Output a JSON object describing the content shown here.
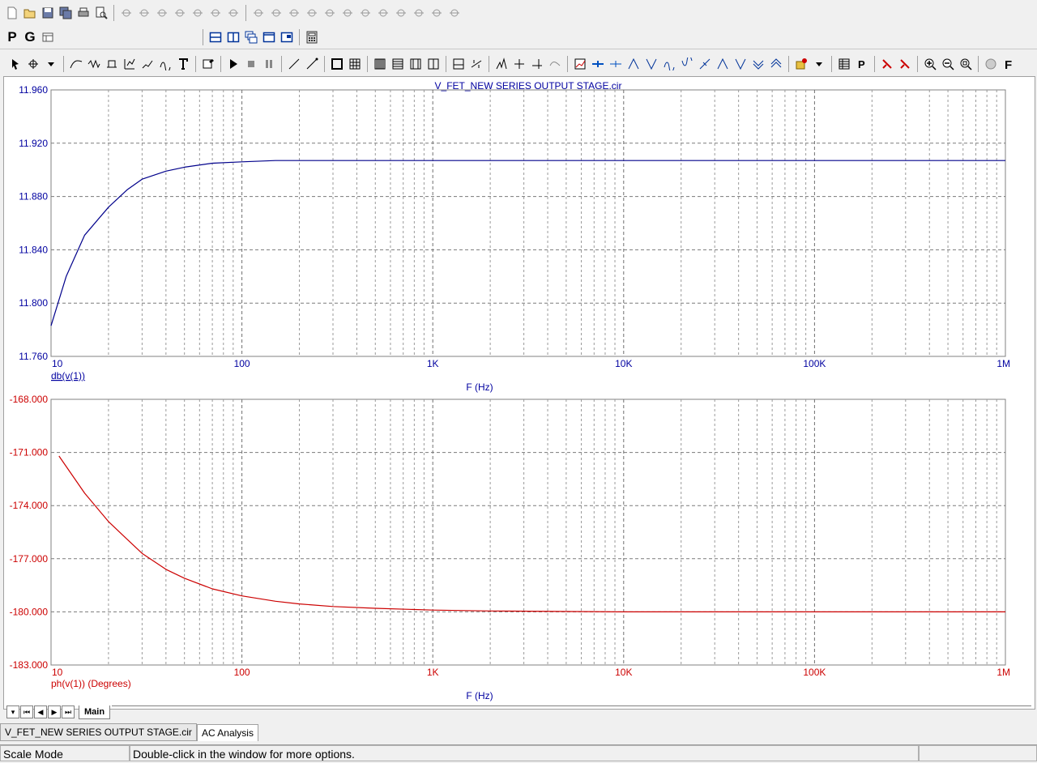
{
  "toolbar1": {
    "icons": [
      "new-file-icon",
      "open-folder-icon",
      "save-icon",
      "save-all-icon",
      "print-icon",
      "print-preview-icon",
      "undo-icon",
      "redo-icon",
      "cut-icon",
      "copy-icon",
      "paste-icon",
      "delete-icon",
      "select-all-icon",
      "ground-icon",
      "resistor-icon",
      "capacitor-icon",
      "inductor-icon",
      "diode-icon",
      "transistor-icon",
      "battery-icon",
      "opamp-icon",
      "source-icon",
      "pin-icon",
      "node-icon",
      "probe-icon"
    ]
  },
  "toolbar2": {
    "p_label": "P",
    "g_label": "G"
  },
  "plot": {
    "title": "V_FET_NEW SERIES OUTPUT STAGE.cir",
    "xlabel": "F (Hz)",
    "x_ticks": [
      "10",
      "100",
      "1K",
      "10K",
      "100K",
      "1M"
    ],
    "top_ticks": [
      "11.960",
      "11.920",
      "11.880",
      "11.840",
      "11.800",
      "11.760"
    ],
    "bottom_ticks": [
      "-168.000",
      "-171.000",
      "-174.000",
      "-177.000",
      "-180.000",
      "-183.000"
    ],
    "top_trace_label": "db(v(1))",
    "bottom_trace_label": "ph(v(1)) (Degrees)",
    "top_color": "#00008b",
    "bottom_color": "#cc0000",
    "axis_label_color": "#0000a0"
  },
  "chart_data": [
    {
      "type": "line",
      "title": "V_FET_NEW SERIES OUTPUT STAGE.cir",
      "xlabel": "F (Hz)",
      "ylabel": "db(v(1))",
      "xscale": "log",
      "xlim": [
        10,
        1000000
      ],
      "ylim": [
        11.76,
        11.96
      ],
      "grid": true,
      "series": [
        {
          "name": "db(v(1))",
          "x": [
            10,
            12,
            15,
            20,
            25,
            30,
            40,
            50,
            70,
            100,
            150,
            200,
            500,
            1000,
            10000,
            100000,
            1000000
          ],
          "values": [
            11.783,
            11.82,
            11.851,
            11.872,
            11.885,
            11.893,
            11.899,
            11.902,
            11.905,
            11.906,
            11.907,
            11.907,
            11.907,
            11.907,
            11.907,
            11.907,
            11.907
          ]
        }
      ]
    },
    {
      "type": "line",
      "xlabel": "F (Hz)",
      "ylabel": "ph(v(1)) (Degrees)",
      "xscale": "log",
      "xlim": [
        10,
        1000000
      ],
      "ylim": [
        -183,
        -168
      ],
      "grid": true,
      "series": [
        {
          "name": "ph(v(1)) (Degrees)",
          "x": [
            11,
            15,
            20,
            25,
            30,
            40,
            50,
            70,
            100,
            150,
            200,
            300,
            500,
            1000,
            2000,
            10000,
            100000,
            1000000
          ],
          "values": [
            -171.2,
            -173.3,
            -174.9,
            -175.9,
            -176.7,
            -177.6,
            -178.1,
            -178.7,
            -179.1,
            -179.4,
            -179.55,
            -179.7,
            -179.8,
            -179.9,
            -179.95,
            -180,
            -180,
            -180
          ]
        }
      ]
    }
  ],
  "sheetbar": {
    "tab": "Main"
  },
  "doctabs": [
    "V_FET_NEW SERIES OUTPUT STAGE.cir",
    "AC Analysis"
  ],
  "status": {
    "mode": "Scale Mode",
    "message": "Double-click in the window for more options."
  }
}
